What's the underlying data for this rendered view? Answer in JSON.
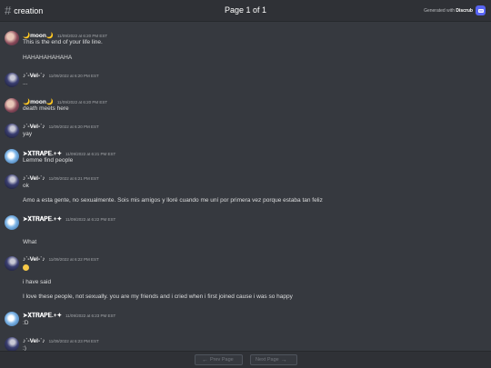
{
  "header": {
    "channel_name": "creation",
    "page_indicator": "Page 1 of 1",
    "generated_prefix": "Generated with ",
    "generated_brand": "Discrub"
  },
  "messages": [
    {
      "author": "🌙moon🌙",
      "avatar": "moon",
      "timestamp": "11/09/2022 at 6:20 PM EST",
      "lines": [
        "This is the end of your life line.",
        "",
        "HAHAHAHAHAHA"
      ]
    },
    {
      "author": "♪˙-Vel-˙♪",
      "avatar": "vel",
      "timestamp": "11/09/2022 at 6:20 PM EST",
      "lines": [
        "..."
      ]
    },
    {
      "author": "🌙moon🌙",
      "avatar": "moon",
      "timestamp": "11/09/2022 at 6:20 PM EST",
      "lines": [
        "death meets here"
      ]
    },
    {
      "author": "♪˙-Vel-˙♪",
      "avatar": "vel",
      "timestamp": "11/09/2022 at 6:20 PM EST",
      "lines": [
        "yay"
      ]
    },
    {
      "author": "➤𝐗𝐓𝐑𝐀𝐏𝐄.+✦",
      "avatar": "xt",
      "timestamp": "11/09/2022 at 6:21 PM EST",
      "lines": [
        "Lemme find people"
      ]
    },
    {
      "author": "♪˙-Vel-˙♪",
      "avatar": "vel",
      "timestamp": "11/09/2022 at 6:21 PM EST",
      "lines": [
        "ok",
        "",
        "Amo a esta gente, no sexualmente. Sois mis amigos y lloré cuando me uní por primera vez porque estaba tan feliz"
      ]
    },
    {
      "author": "➤𝐗𝐓𝐑𝐀𝐏𝐄.+✦",
      "avatar": "xt",
      "timestamp": "11/09/2022 at 6:22 PM EST",
      "lines": [
        "",
        "What"
      ]
    },
    {
      "author": "♪˙-Vel-˙♪",
      "avatar": "vel",
      "timestamp": "11/09/2022 at 6:22 PM EST",
      "lines": [
        "😊",
        "",
        "i have said",
        "",
        "I love these people, not sexually. you are my friends and i cried when i first joined cause i was so happy"
      ]
    },
    {
      "author": "➤𝐗𝐓𝐑𝐀𝐏𝐄.+✦",
      "avatar": "xt",
      "timestamp": "11/09/2022 at 6:23 PM EST",
      "lines": [
        ":D"
      ]
    },
    {
      "author": "♪˙-Vel-˙♪",
      "avatar": "vel",
      "timestamp": "11/09/2022 at 6:23 PM EST",
      "lines": [
        ":)"
      ]
    }
  ],
  "footer": {
    "prev_label": "Prev Page",
    "next_label": "Next Page"
  },
  "colors": {
    "background": "#36393f",
    "header": "#2f3136",
    "brand": "#5865f2"
  },
  "icons": [
    "hashtag-icon",
    "discrub-logo-icon",
    "arrow-left-icon",
    "arrow-right-icon"
  ]
}
